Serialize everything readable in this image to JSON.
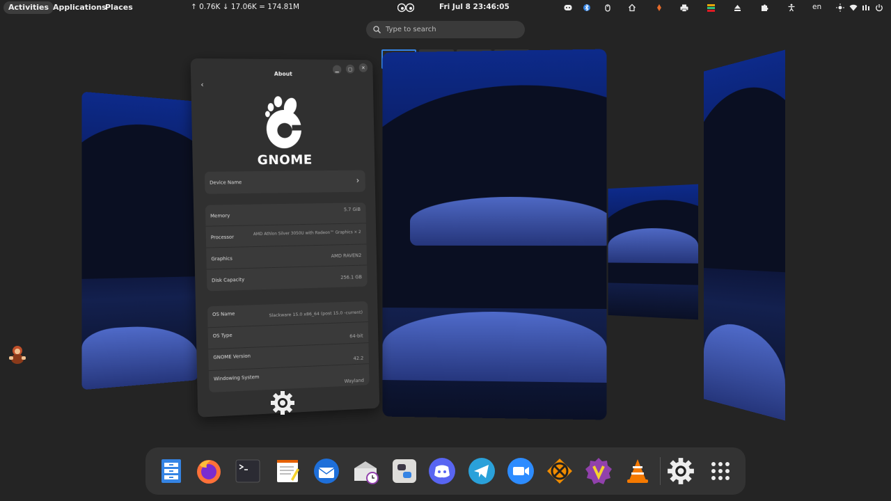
{
  "topbar": {
    "activities": "Activities",
    "applications": "Applications",
    "places": "Places",
    "netspeed": "↑ 0.76K ↓ 17.06K = 174.81M",
    "clock": "Fri Jul 8  23:46:05",
    "language": "en"
  },
  "search": {
    "placeholder": "Type to search"
  },
  "about_window": {
    "title": "About",
    "logo_text": "GNOME",
    "device_name_label": "Device Name",
    "hardware": [
      {
        "label": "Memory",
        "value": "5.7 GiB"
      },
      {
        "label": "Processor",
        "value": "AMD Athlon Silver 3050U with Radeon™ Graphics × 2"
      },
      {
        "label": "Graphics",
        "value": "AMD RAVEN2"
      },
      {
        "label": "Disk Capacity",
        "value": "256.1 GB"
      }
    ],
    "software": [
      {
        "label": "OS Name",
        "value": "Slackware 15.0 x86_64 (post 15.0 -current)"
      },
      {
        "label": "OS Type",
        "value": "64-bit"
      },
      {
        "label": "GNOME Version",
        "value": "42.2"
      },
      {
        "label": "Windowing System",
        "value": "Wayland"
      }
    ]
  },
  "dock": {
    "apps": [
      "files",
      "firefox",
      "terminal",
      "text-editor",
      "thunderbird",
      "mail-scheduler",
      "software",
      "discord",
      "telegram",
      "zoom",
      "crossover",
      "vivaldi",
      "vlc",
      "settings",
      "show-applications"
    ]
  }
}
